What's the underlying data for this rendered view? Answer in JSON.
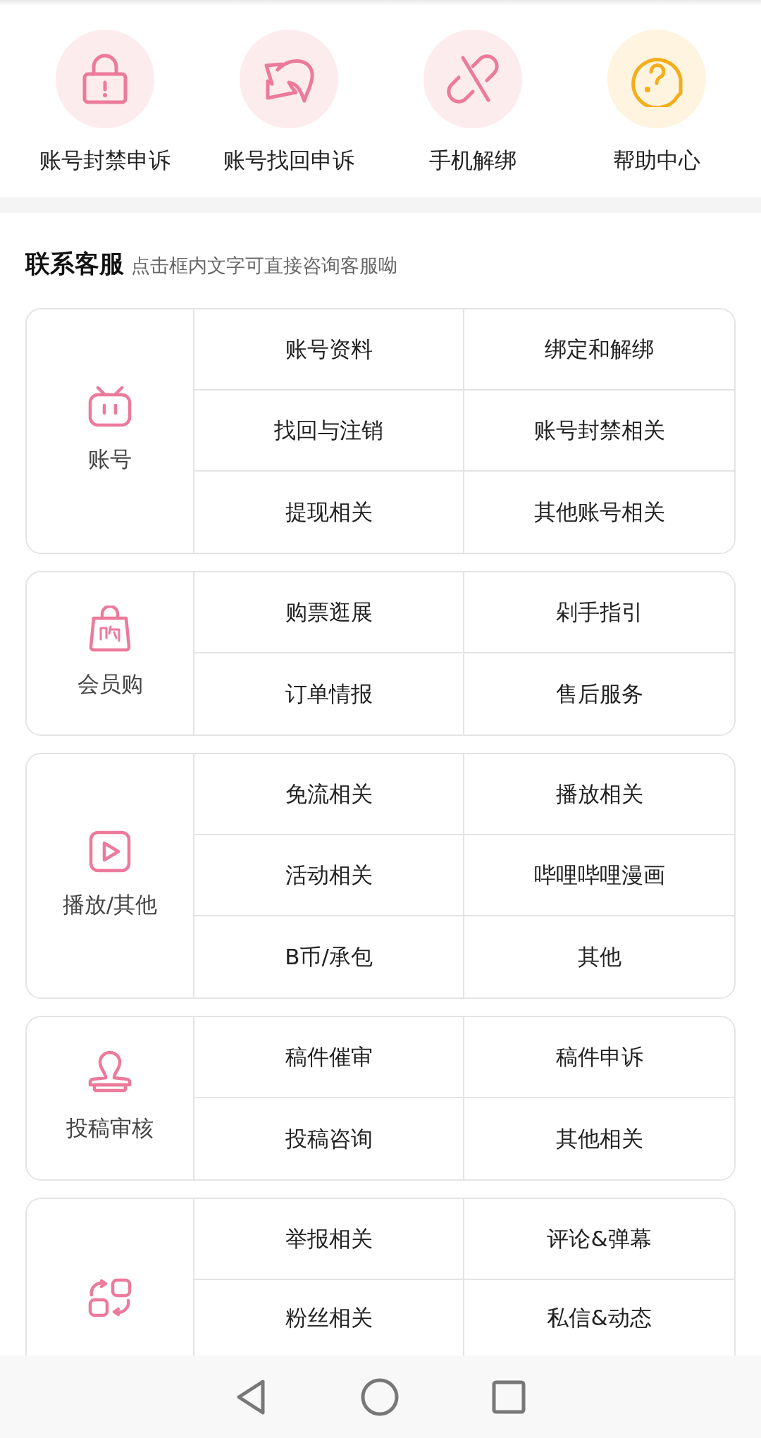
{
  "shortcuts": [
    {
      "label": "账号封禁申诉",
      "kind": "lock"
    },
    {
      "label": "账号找回申诉",
      "kind": "return"
    },
    {
      "label": "手机解绑",
      "kind": "unlink"
    },
    {
      "label": "帮助中心",
      "kind": "help"
    }
  ],
  "contact": {
    "title": "联系客服",
    "subtitle": "点击框内文字可直接咨询客服呦"
  },
  "categories": [
    {
      "label": "账号",
      "kind": "tv",
      "items": [
        "账号资料",
        "绑定和解绑",
        "找回与注销",
        "账号封禁相关",
        "提现相关",
        "其他账号相关"
      ]
    },
    {
      "label": "会员购",
      "kind": "bag",
      "items": [
        "购票逛展",
        "剁手指引",
        "订单情报",
        "售后服务"
      ]
    },
    {
      "label": "播放/其他",
      "kind": "play",
      "items": [
        "免流相关",
        "播放相关",
        "活动相关",
        "哔哩哔哩漫画",
        "B币/承包",
        "其他"
      ]
    },
    {
      "label": "投稿审核",
      "kind": "stamp",
      "items": [
        "稿件催审",
        "稿件申诉",
        "投稿咨询",
        "其他相关"
      ]
    },
    {
      "kind": "swap",
      "items": [
        "举报相关",
        "评论&弹幕",
        "粉丝相关",
        "私信&动态"
      ]
    }
  ]
}
